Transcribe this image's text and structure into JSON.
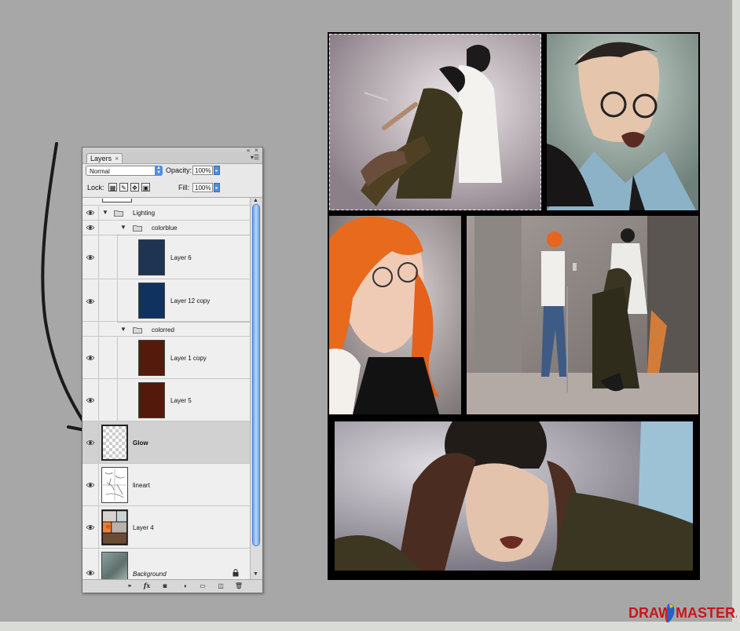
{
  "panel": {
    "tab_label": "Layers",
    "tab_close": "×",
    "blend_mode": "Normal",
    "opacity_label": "Opacity:",
    "opacity_value": "100%",
    "lock_label": "Lock:",
    "fill_label": "Fill:",
    "fill_value": "100%"
  },
  "layers": [
    {
      "name": "Lighting",
      "kind": "group",
      "indent": 0
    },
    {
      "name": "colorblue",
      "kind": "group",
      "indent": 1
    },
    {
      "name": "Layer 6",
      "kind": "layer",
      "thumb_color": "#1f3352"
    },
    {
      "name": "Layer 12 copy",
      "kind": "layer",
      "thumb_color": "#10325e"
    },
    {
      "name": "colorred",
      "kind": "group",
      "indent": 1
    },
    {
      "name": "Layer 1 copy",
      "kind": "layer",
      "thumb_color": "#541a0c"
    },
    {
      "name": "Layer 5",
      "kind": "layer",
      "thumb_color": "#531a0c"
    },
    {
      "name": "Glow",
      "kind": "layer",
      "selected": true,
      "thumb": "transparent"
    },
    {
      "name": "lineart",
      "kind": "layer",
      "thumb": "lineart"
    },
    {
      "name": "Layer 4",
      "kind": "layer",
      "thumb": "color"
    },
    {
      "name": "Background",
      "kind": "layer",
      "locked": true,
      "thumb": "background"
    }
  ],
  "icons": {
    "lock_icons": [
      "lock-transparency-icon",
      "lock-image-icon",
      "lock-position-icon",
      "lock-all-icon"
    ],
    "bottom_icons": [
      "link-layers-icon",
      "fx-icon",
      "layer-mask-icon",
      "adjustment-layer-icon",
      "new-group-icon",
      "new-layer-icon",
      "trash-icon"
    ],
    "fx_glyph": "fx"
  },
  "watermark": {
    "text_a": "DRAW",
    "text_b": "MASTER.RU"
  },
  "colors": {
    "canvas_bg": "#a7a7a7",
    "outer_bg": "#d9dcd6",
    "selection_blue": "#4f8ee0",
    "watermark_red": "#c8161b"
  }
}
